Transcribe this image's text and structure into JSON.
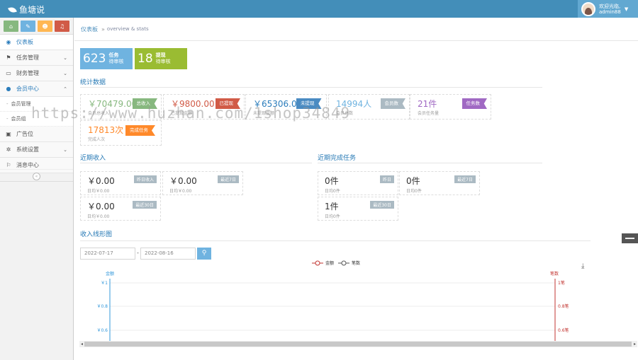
{
  "app": {
    "title": "鱼塘说"
  },
  "user": {
    "welcome": "欢迎光临,",
    "name": "admin88"
  },
  "shortcuts": [
    {
      "icon": "home-icon",
      "glyph": "⌂",
      "color": "#87b87f"
    },
    {
      "icon": "pencil-icon",
      "glyph": "✎",
      "color": "#6fb3e0"
    },
    {
      "icon": "group-icon",
      "glyph": "☻",
      "color": "#ffb752"
    },
    {
      "icon": "bell-icon",
      "glyph": "♫",
      "color": "#d15b47"
    }
  ],
  "sidebar": {
    "items": [
      {
        "label": "仪表板",
        "icon": "dashboard-icon",
        "glyph": "◉",
        "state": "active",
        "arrow": ""
      },
      {
        "label": "任务管理",
        "icon": "flag-icon",
        "glyph": "⚑",
        "state": "",
        "arrow": "⌄"
      },
      {
        "label": "财务管理",
        "icon": "desktop-icon",
        "glyph": "▭",
        "state": "",
        "arrow": "⌄"
      },
      {
        "label": "会员中心",
        "icon": "user-icon",
        "glyph": "●",
        "state": "open",
        "arrow": "⌃"
      }
    ],
    "subitems": [
      {
        "label": "会员管理"
      },
      {
        "label": "会员组"
      }
    ],
    "items2": [
      {
        "label": "广告位",
        "icon": "picture-icon",
        "glyph": "▣",
        "arrow": ""
      },
      {
        "label": "系统设置",
        "icon": "cog-icon",
        "glyph": "✲",
        "arrow": "⌄"
      },
      {
        "label": "消息中心",
        "icon": "bookmark-icon",
        "glyph": "⚐",
        "arrow": ""
      }
    ],
    "collapse_glyph": "«"
  },
  "breadcrumb": {
    "home": "仪表板",
    "sep": "»",
    "sub": "overview & stats"
  },
  "infoboxes": [
    {
      "number": "623",
      "title": "任务",
      "sub": "待审核",
      "color": "#6fb3e0"
    },
    {
      "number": "18",
      "title": "提现",
      "sub": "待审核",
      "color": "#9abc32"
    }
  ],
  "sections": {
    "stats": "统计数据",
    "income": "近期收入",
    "tasks": "近期完成任务",
    "chart": "收入线形图"
  },
  "stats": [
    {
      "value": "￥70479.00",
      "sub": "会员总收入",
      "ribbon": "总收入",
      "color": "#87b87f",
      "ribbon_color": "#87b87f"
    },
    {
      "value": "￥9800.00",
      "sub": "已提现金额",
      "ribbon": "已提现",
      "color": "#d15b47",
      "ribbon_color": "#d15b47"
    },
    {
      "value": "￥65306.00",
      "sub": "未提现金额",
      "ribbon": "未提现",
      "color": "#2b7dbc",
      "ribbon_color": "#4a8bc2"
    },
    {
      "value": "14994人",
      "sub": "会员总数",
      "ribbon": "会员数",
      "color": "#6fb3e0",
      "ribbon_color": "#abbac3"
    },
    {
      "value": "21件",
      "sub": "会员任务量",
      "ribbon": "任务数",
      "color": "#a069c3",
      "ribbon_color": "#a069c3"
    },
    {
      "value": "17813次",
      "sub": "完成人次",
      "ribbon": "完成任务",
      "color": "#ff892a",
      "ribbon_color": "#ff892a"
    }
  ],
  "income": [
    {
      "value": "￥0.00",
      "sub": "日均￥0.00",
      "tag": "昨日收入"
    },
    {
      "value": "￥0.00",
      "sub": "日均￥0.00",
      "tag": "最近7日"
    },
    {
      "value": "￥0.00",
      "sub": "日均￥0.00",
      "tag": "最近30日"
    }
  ],
  "tasks": [
    {
      "value": "0件",
      "sub": "日均0件",
      "tag": "昨日"
    },
    {
      "value": "0件",
      "sub": "日均0件",
      "tag": "最近7日"
    },
    {
      "value": "1件",
      "sub": "日均0件",
      "tag": "最近30日"
    }
  ],
  "chart_filter": {
    "start": "2022-07-17",
    "dash": "-",
    "end": "2022-08-16",
    "search_glyph": "⚲"
  },
  "chart_data": {
    "type": "line",
    "legend": [
      "金额",
      "笔数"
    ],
    "left_axis": {
      "name": "金额",
      "ticks": [
        "￥1",
        "￥0.8",
        "￥0.6"
      ],
      "color": "#3398db"
    },
    "right_axis": {
      "name": "笔数",
      "ticks": [
        "1笔",
        "0.8笔",
        "0.6笔"
      ],
      "color": "#c23531"
    },
    "series": [
      {
        "name": "金额",
        "values": [],
        "color": "#c23531"
      },
      {
        "name": "笔数",
        "values": [],
        "color": "#555555"
      }
    ],
    "download_glyph": "⤓"
  },
  "watermark": "https://www.huzhan.com/1shop34849"
}
